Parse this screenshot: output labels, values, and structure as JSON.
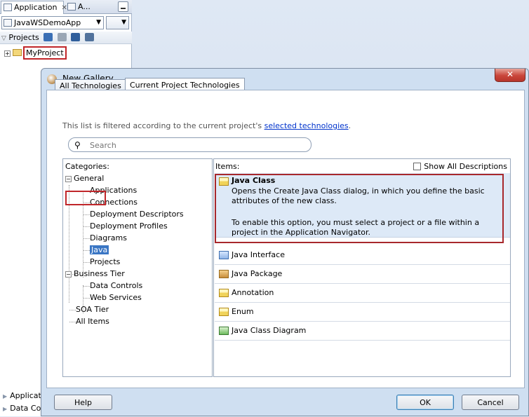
{
  "ide": {
    "tabs": [
      {
        "label": "Application"
      },
      {
        "label": "A..."
      }
    ],
    "app_combo_value": "JavaWSDemoApp",
    "projects_label": "Projects",
    "tree_root": "MyProject",
    "bottom_items": [
      "Application",
      "Data Co"
    ]
  },
  "dialog": {
    "title": "New Gallery",
    "tabs": [
      {
        "label": "All Technologies"
      },
      {
        "label": "Current Project Technologies"
      }
    ],
    "filter_note_prefix": "This list is filtered according to the current project's ",
    "filter_note_link": "selected technologies",
    "filter_note_suffix": ".",
    "search_placeholder": "Search",
    "categories_label": "Categories:",
    "categories": {
      "general": "General",
      "general_children": [
        "Applications",
        "Connections",
        "Deployment Descriptors",
        "Deployment Profiles",
        "Diagrams",
        "Java",
        "Projects"
      ],
      "business_tier": "Business Tier",
      "business_children": [
        "Data Controls",
        "Web Services"
      ],
      "soa_tier": "SOA Tier",
      "all_items": "All Items"
    },
    "selected_category": "Java",
    "items_label": "Items:",
    "show_all_descriptions": "Show All Descriptions",
    "selected_item": {
      "title": "Java Class",
      "description": "Opens the Create Java Class dialog, in which you define the basic attributes of the new class.",
      "note": "To enable this option, you must select a project or a file within a project in the Application Navigator."
    },
    "items": [
      "Java Interface",
      "Java Package",
      "Annotation",
      "Enum",
      "Java Class Diagram"
    ],
    "buttons": {
      "help": "Help",
      "ok": "OK",
      "cancel": "Cancel"
    }
  },
  "colors": {
    "highlight_border": "#c0262a",
    "selection": "#3a76c4",
    "item_selected_bg": "#dde9f7"
  }
}
